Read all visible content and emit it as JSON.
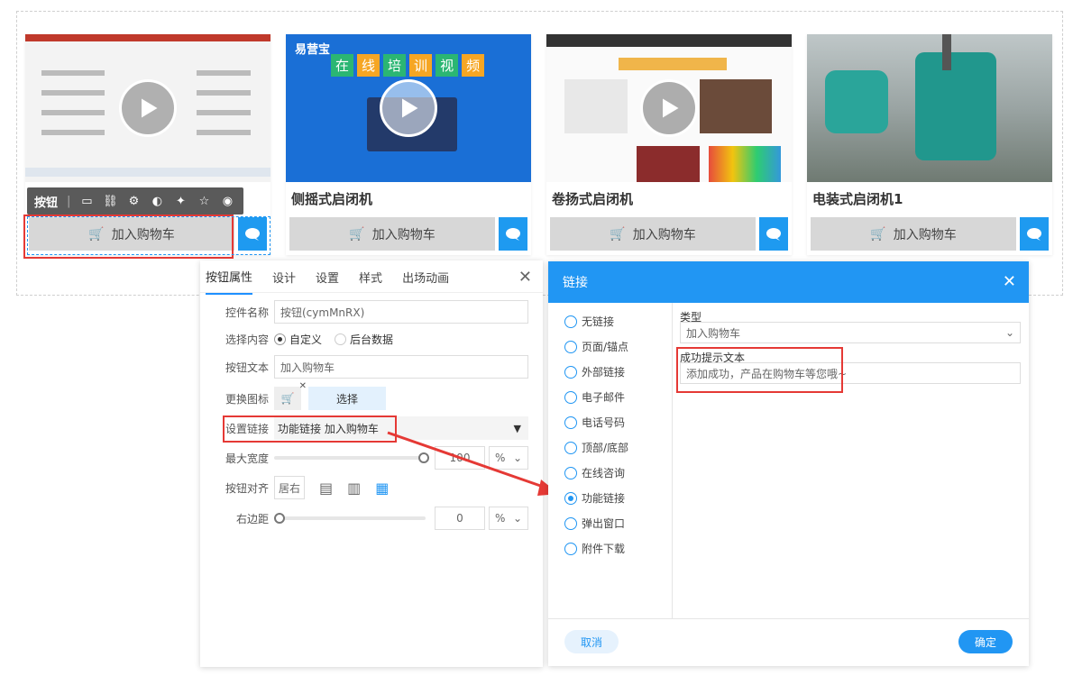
{
  "toolbar": {
    "label": "按钮"
  },
  "cards": [
    {
      "title": "",
      "cart_label": "加入购物车"
    },
    {
      "title": "侧摇式启闭机",
      "cart_label": "加入购物车",
      "brand": "易营宝",
      "banner": [
        "在",
        "线",
        "培",
        "训",
        "视",
        "频"
      ]
    },
    {
      "title": "卷扬式启闭机",
      "cart_label": "加入购物车"
    },
    {
      "title": "电装式启闭机1",
      "cart_label": "加入购物车"
    }
  ],
  "left_panel": {
    "tabs": [
      "按钮属性",
      "设计",
      "设置",
      "样式",
      "出场动画"
    ],
    "control_name_label": "控件名称",
    "control_name_value": "按钮(cymMnRX)",
    "content_label": "选择内容",
    "content_opt_custom": "自定义",
    "content_opt_backend": "后台数据",
    "btn_text_label": "按钮文本",
    "btn_text_value": "加入购物车",
    "icon_label": "更换图标",
    "icon_choose": "选择",
    "link_label": "设置链接",
    "link_value": "功能链接 加入购物车",
    "maxwidth_label": "最大宽度",
    "maxwidth_value": "100",
    "maxwidth_unit": "%",
    "align_label": "按钮对齐",
    "align_value": "居右",
    "margin_label": "右边距",
    "margin_value": "0",
    "margin_unit": "%"
  },
  "dialog": {
    "title": "链接",
    "options": [
      "无链接",
      "页面/锚点",
      "外部链接",
      "电子邮件",
      "电话号码",
      "顶部/底部",
      "在线咨询",
      "功能链接",
      "弹出窗口",
      "附件下载"
    ],
    "selected_index": 7,
    "type_label": "类型",
    "type_value": "加入购物车",
    "success_label": "成功提示文本",
    "success_value": "添加成功，产品在购物车等您哦~",
    "cancel": "取消",
    "ok": "确定"
  },
  "colors": {
    "accent": "#2196f3",
    "highlight": "#e53935",
    "cart_bg": "#d7d7d7"
  }
}
